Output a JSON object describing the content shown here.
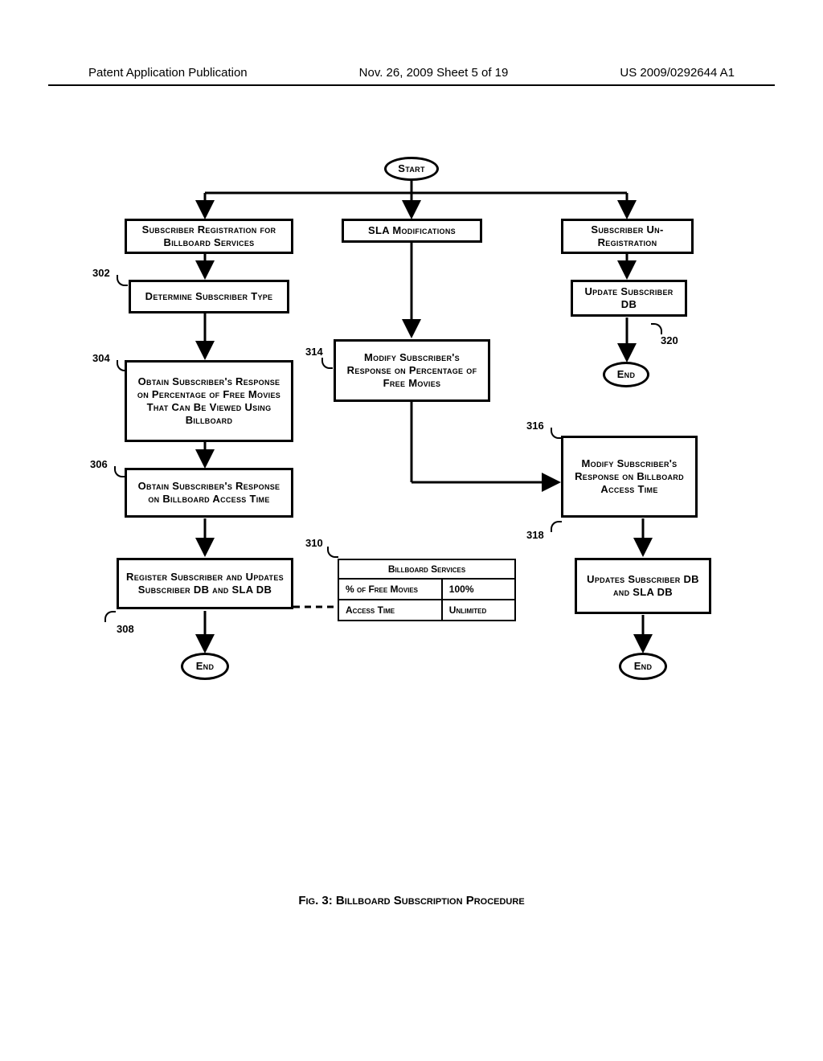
{
  "header": {
    "left": "Patent Application Publication",
    "mid": "Nov. 26, 2009  Sheet 5 of 19",
    "right": "US 2009/0292644 A1"
  },
  "nodes": {
    "start": "Start",
    "sub_reg": "Subscriber Registration for Billboard Services",
    "sla_mod": "SLA Modifications",
    "sub_unreg": "Subscriber Un-Registration",
    "det_type": "Determine Subscriber Type",
    "update_db": "Update Subscriber DB",
    "end3": "End",
    "obtain_pct": "Obtain Subscriber's Response on Percentage of Free Movies That Can Be Viewed Using Billboard",
    "modify_pct": "Modify Subscriber's Response on Percentage of Free Movies",
    "obtain_time": "Obtain Subscriber's Response on Billboard Access Time",
    "modify_time": "Modify Subscriber's Response on Billboard Access Time",
    "reg_update": "Register Subscriber and Updates Subscriber DB and SLA DB",
    "updates2": "Updates Subscriber DB and SLA DB",
    "end1": "End",
    "end2": "End"
  },
  "table": {
    "title": "Billboard Services",
    "r1a": "% of Free Movies",
    "r1b": "100%",
    "r2a": "Access Time",
    "r2b": "Unlimited"
  },
  "refs": {
    "r302": "302",
    "r304": "304",
    "r306": "306",
    "r308": "308",
    "r310": "310",
    "r314": "314",
    "r316": "316",
    "r318": "318",
    "r320": "320"
  },
  "caption": "Fig. 3: Billboard Subscription Procedure"
}
